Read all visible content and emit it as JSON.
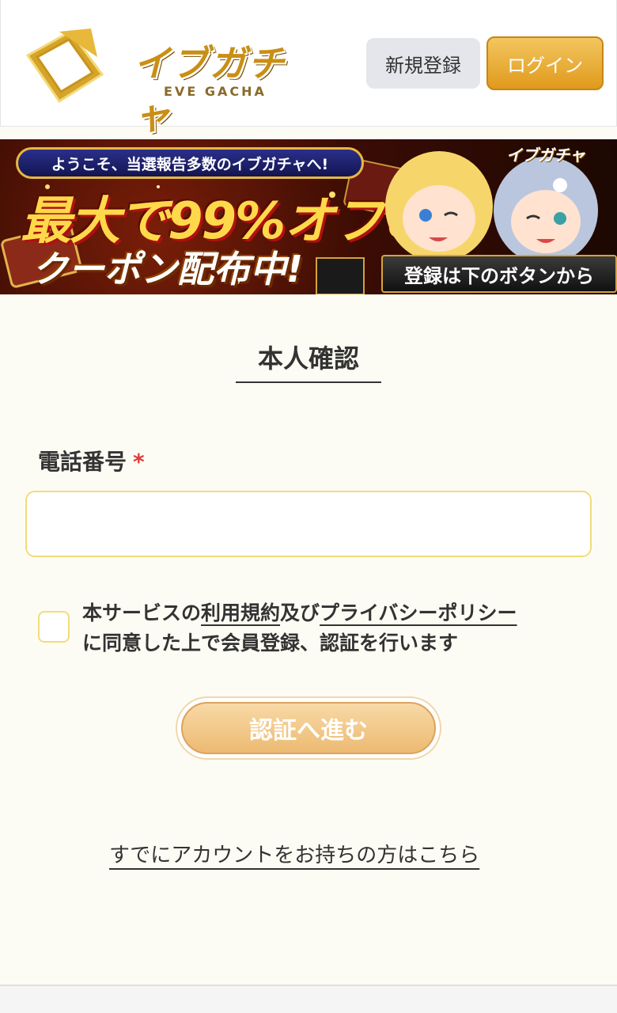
{
  "header": {
    "logo_text": "イブガチャ",
    "logo_sub": "EVE GACHA",
    "register_label": "新規登録",
    "login_label": "ログイン"
  },
  "banner": {
    "welcome": "ようこそ、当選報告多数のイブガチャへ!",
    "main": "最大で99%オフの",
    "sub": "クーポン配布中!",
    "cta": "登録は下のボタンから",
    "logo": "イブガチャ"
  },
  "form": {
    "title": "本人確認",
    "phone_label": "電話番号",
    "required_mark": "*",
    "phone_value": "",
    "agree_prefix": "本サービスの",
    "terms_link": "利用規約",
    "agree_and": "及び",
    "privacy_link": "プライバシーポリシー",
    "agree_suffix": "に同意した上で会員登録、認証を行います",
    "submit_label": "認証へ進む",
    "have_account": "すでにアカウントをお持ちの方はこちら"
  }
}
